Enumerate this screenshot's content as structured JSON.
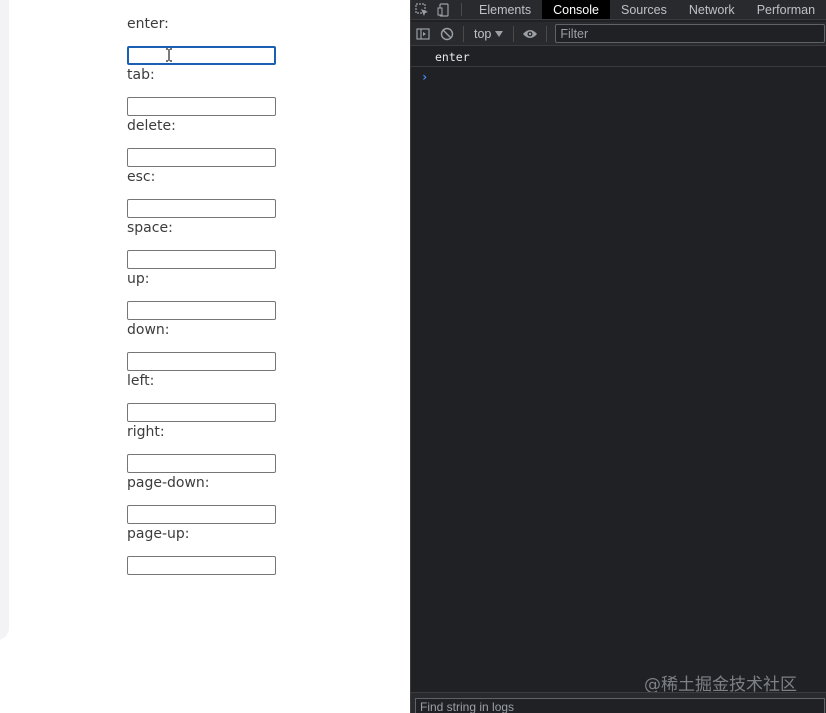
{
  "form": {
    "fields": [
      {
        "label": "enter:",
        "value": "",
        "focused": true
      },
      {
        "label": "tab:",
        "value": ""
      },
      {
        "label": "delete:",
        "value": ""
      },
      {
        "label": "esc:",
        "value": ""
      },
      {
        "label": "space:",
        "value": ""
      },
      {
        "label": "up:",
        "value": ""
      },
      {
        "label": "down:",
        "value": ""
      },
      {
        "label": "left:",
        "value": ""
      },
      {
        "label": "right:",
        "value": ""
      },
      {
        "label": "page-down:",
        "value": ""
      },
      {
        "label": "page-up:",
        "value": ""
      }
    ]
  },
  "devtools": {
    "tabs": [
      "Elements",
      "Console",
      "Sources",
      "Network",
      "Performan"
    ],
    "active_tab": "Console",
    "toolbar": {
      "context": "top",
      "filter_placeholder": "Filter"
    },
    "console_logs": [
      "enter"
    ],
    "prompt_symbol": "›",
    "find_placeholder": "Find string in logs",
    "watermark": "@稀土掘金技术社区"
  },
  "colors": {
    "devtools_bg": "#202124",
    "toolbar_bg": "#292a2d",
    "focus_border": "#1a5fb4",
    "prompt_blue": "#4d90fe"
  }
}
